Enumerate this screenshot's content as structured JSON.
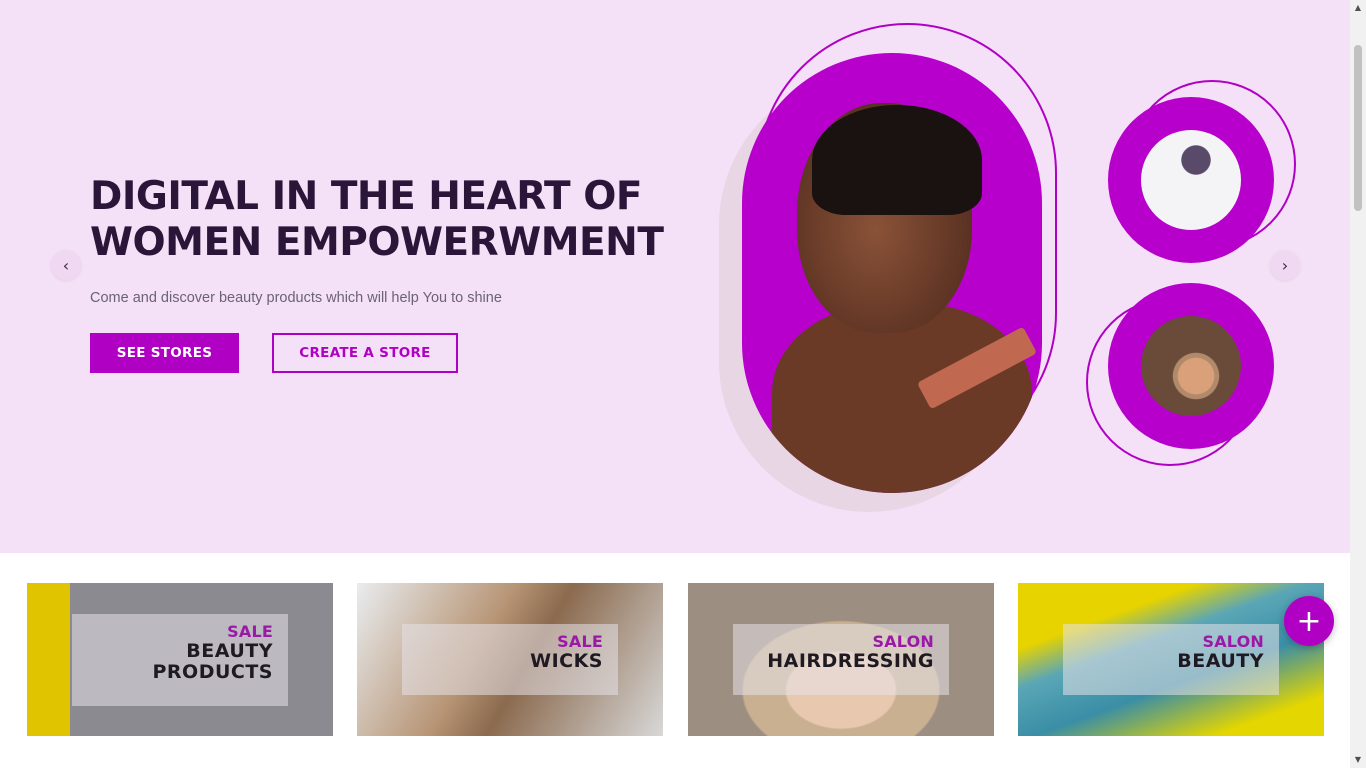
{
  "hero": {
    "title_line1": "DIGITAL IN THE HEART OF",
    "title_line2": "WOMEN EMPOWERWMENT",
    "subtitle": "Come and discover beauty products which will help You to shine",
    "primary_button": "SEE STORES",
    "secondary_button": "CREATE A STORE",
    "prev_icon": "‹",
    "next_icon": "›"
  },
  "categories": [
    {
      "tag": "SALE",
      "name_line1": "BEAUTY",
      "name_line2": "PRODUCTS"
    },
    {
      "tag": "SALE",
      "name_line1": "WICKS"
    },
    {
      "tag": "SALON",
      "name_line1": "HAIRDRESSING"
    },
    {
      "tag": "SALON",
      "name_line1": "BEAUTY"
    }
  ],
  "fab": {
    "icon": "+"
  },
  "scrollbar": {
    "up": "▲",
    "down": "▼"
  },
  "colors": {
    "accent": "#b000c4",
    "hero_background": "#f5e1f7",
    "title": "#2a1638"
  }
}
